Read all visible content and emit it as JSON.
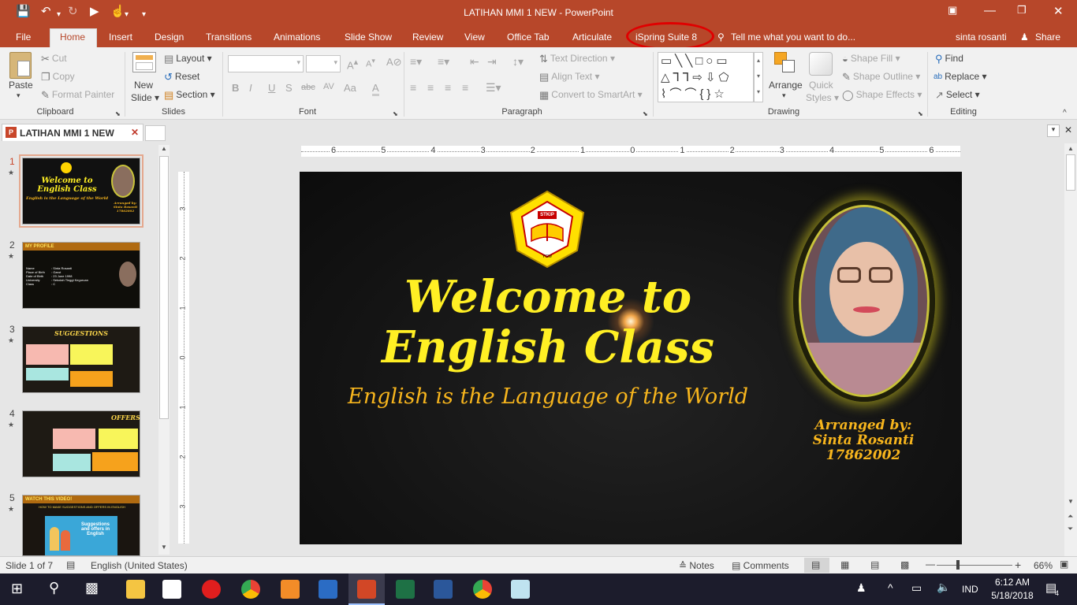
{
  "title": "LATIHAN MMI 1 NEW - PowerPoint",
  "tabs": [
    "File",
    "Home",
    "Insert",
    "Design",
    "Transitions",
    "Animations",
    "Slide Show",
    "Review",
    "View",
    "Office Tab",
    "Articulate",
    "iSpring Suite 8"
  ],
  "tell_me": "Tell me what you want to do...",
  "user": "sinta rosanti",
  "share": "Share",
  "clipboard": {
    "paste": "Paste",
    "cut": "Cut",
    "copy": "Copy",
    "format_painter": "Format Painter",
    "label": "Clipboard"
  },
  "slides_group": {
    "new_slide_1": "New",
    "new_slide_2": "Slide",
    "layout": "Layout",
    "reset": "Reset",
    "section": "Section",
    "label": "Slides"
  },
  "font_group": {
    "bold": "B",
    "italic": "I",
    "underline": "U",
    "strike": "S",
    "shadow": "abc",
    "spacing": "AV",
    "case": "Aa",
    "label": "Font"
  },
  "paragraph_group": {
    "text_direction": "Text Direction",
    "align_text": "Align Text",
    "smartart": "Convert to SmartArt",
    "label": "Paragraph"
  },
  "drawing_group": {
    "arrange": "Arrange",
    "quick_styles_1": "Quick",
    "quick_styles_2": "Styles",
    "shape_fill": "Shape Fill",
    "shape_outline": "Shape Outline",
    "shape_effects": "Shape Effects",
    "label": "Drawing"
  },
  "editing_group": {
    "find": "Find",
    "replace": "Replace",
    "select": "Select",
    "label": "Editing"
  },
  "doc_tab": "LATIHAN MMI 1 NEW",
  "hruler_numbers": [
    "6",
    "5",
    "4",
    "3",
    "2",
    "1",
    "0",
    "1",
    "2",
    "3",
    "4",
    "5",
    "6"
  ],
  "vruler_numbers": [
    "3",
    "2",
    "1",
    "0",
    "1",
    "2",
    "3"
  ],
  "thumbnails": [
    {
      "num": "1",
      "star": "★",
      "title": "Welcome to English Class",
      "sub": "English is the Language of the World",
      "note": "Arranged by: Sinta Rosanti 17862002"
    },
    {
      "num": "2",
      "star": "★",
      "title": "MY PROFILE",
      "rows": [
        "Name",
        "Place of Birth",
        "Date of Birth",
        "University",
        "Class"
      ],
      "vals": [
        ": Sinta Rosanti",
        ": Garut",
        ": 23 June 1998",
        ": Sekolah Tinggi Keguruan",
        ": C"
      ]
    },
    {
      "num": "3",
      "star": "★",
      "title": "SUGGESTIONS"
    },
    {
      "num": "4",
      "star": "★",
      "title": "OFFERS"
    },
    {
      "num": "5",
      "star": "★",
      "title": "WATCH THIS VIDEO!",
      "sub": "HOW TO MAKE SUGGESTIONS AND OFFERS IN ENGLISH",
      "inner": "Suggestions and offers in English"
    }
  ],
  "slide": {
    "title_line1": "Welcome to",
    "title_line2": "English Class",
    "subtitle": "English is the Language of the World",
    "arranged_1": "Arranged by:",
    "arranged_2": "Sinta Rosanti",
    "arranged_3": "17862002",
    "logo_top": "STKIP",
    "logo_arc": "SEKOLAH TINGGI KEGURUAN DAN ILMU PENDIDIKAN",
    "logo_bottom": "G A R U T",
    "logo_ycw": "YGW"
  },
  "status": {
    "slide_of": "Slide 1 of 7",
    "language": "English (United States)",
    "notes": "Notes",
    "comments": "Comments",
    "zoom": "66%"
  },
  "taskbar": {
    "lang": "IND",
    "time": "6:12 AM",
    "date": "5/18/2018",
    "notif": "4"
  },
  "colors": {
    "accent": "#b7472a",
    "slide_title": "#ffef24",
    "slide_sub": "#f7b51d",
    "highlight_circle": "#e00000"
  }
}
